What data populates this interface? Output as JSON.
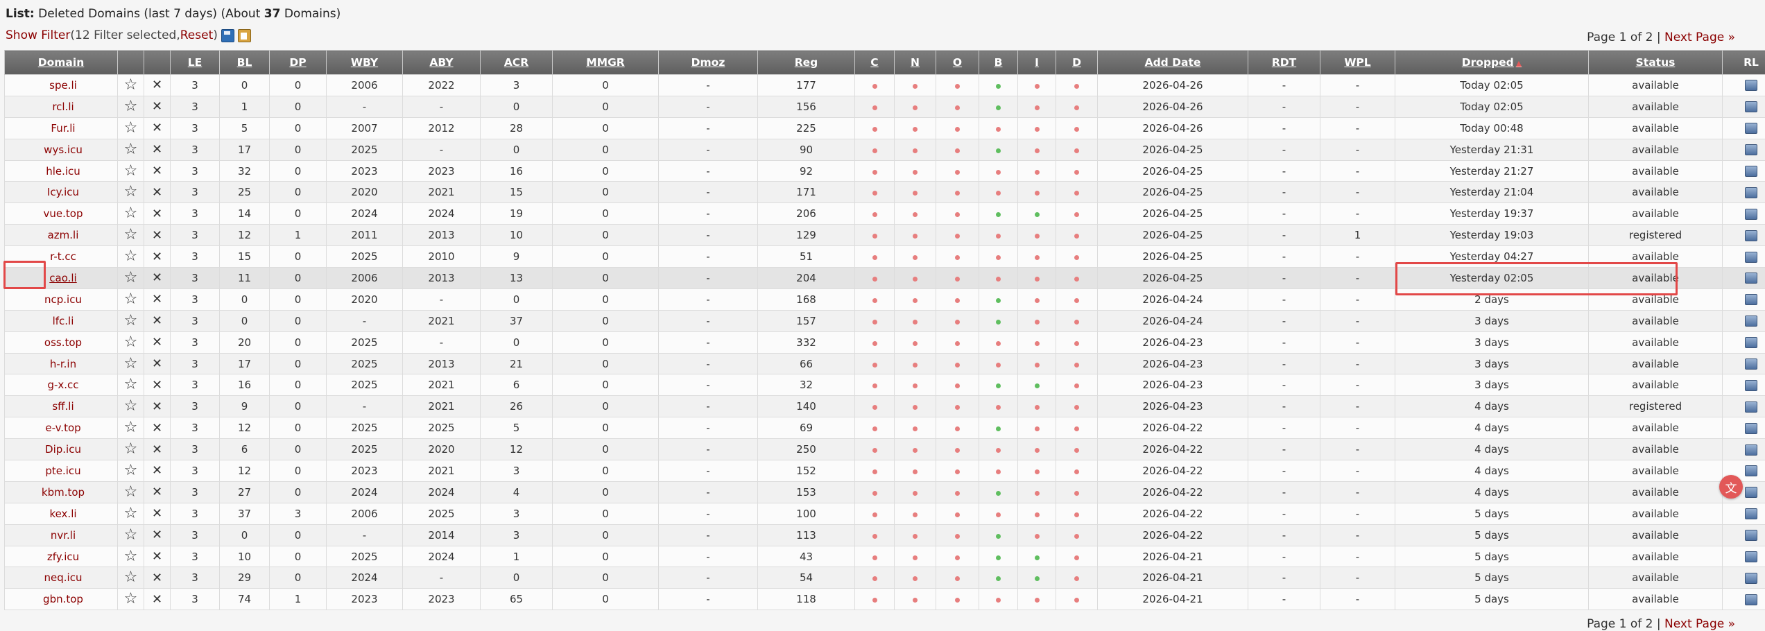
{
  "header": {
    "list_label": "List:",
    "list_prefix": " Deleted Domains (last 7 days) (About ",
    "count": "37",
    "list_suffix": " Domains)"
  },
  "filter": {
    "show_filter": "Show Filter",
    "open": " (",
    "info": "12 Filter selected, ",
    "reset": "Reset",
    "close": ")",
    "save_icon": "save-icon",
    "clipboard_icon": "clipboard-icon"
  },
  "pager": {
    "text": "Page 1 of 2 | ",
    "next": "Next Page »"
  },
  "columns": [
    "Domain",
    "",
    "",
    "LE",
    "BL",
    "DP",
    "WBY",
    "ABY",
    "ACR",
    "MMGR",
    "Dmoz",
    "Reg",
    "C",
    "N",
    "O",
    "B",
    "I",
    "D",
    "Add Date",
    "RDT",
    "WPL",
    "Dropped",
    "Status",
    "RL"
  ],
  "rows": [
    {
      "domain": "spe.li",
      "le": "3",
      "bl": "0",
      "dp": "0",
      "wby": "2006",
      "aby": "2022",
      "acr": "3",
      "mmgr": "0",
      "dmoz": "-",
      "reg": "177",
      "c": "r",
      "n": "r",
      "o": "r",
      "b": "g",
      "i": "r",
      "d": "r",
      "add_date": "2026-04-26",
      "rdt": "-",
      "wpl": "-",
      "dropped": "Today 02:05",
      "status": "available"
    },
    {
      "domain": "rcl.li",
      "le": "3",
      "bl": "1",
      "dp": "0",
      "wby": "-",
      "aby": "-",
      "acr": "0",
      "mmgr": "0",
      "dmoz": "-",
      "reg": "156",
      "c": "r",
      "n": "r",
      "o": "r",
      "b": "g",
      "i": "r",
      "d": "r",
      "add_date": "2026-04-26",
      "rdt": "-",
      "wpl": "-",
      "dropped": "Today 02:05",
      "status": "available"
    },
    {
      "domain": "Fur.li",
      "le": "3",
      "bl": "5",
      "dp": "0",
      "wby": "2007",
      "aby": "2012",
      "acr": "28",
      "mmgr": "0",
      "dmoz": "-",
      "reg": "225",
      "c": "r",
      "n": "r",
      "o": "r",
      "b": "r",
      "i": "r",
      "d": "r",
      "add_date": "2026-04-26",
      "rdt": "-",
      "wpl": "-",
      "dropped": "Today 00:48",
      "status": "available"
    },
    {
      "domain": "wys.icu",
      "le": "3",
      "bl": "17",
      "dp": "0",
      "wby": "2025",
      "aby": "-",
      "acr": "0",
      "mmgr": "0",
      "dmoz": "-",
      "reg": "90",
      "c": "r",
      "n": "r",
      "o": "r",
      "b": "g",
      "i": "r",
      "d": "r",
      "add_date": "2026-04-25",
      "rdt": "-",
      "wpl": "-",
      "dropped": "Yesterday 21:31",
      "status": "available"
    },
    {
      "domain": "hle.icu",
      "le": "3",
      "bl": "32",
      "dp": "0",
      "wby": "2023",
      "aby": "2023",
      "acr": "16",
      "mmgr": "0",
      "dmoz": "-",
      "reg": "92",
      "c": "r",
      "n": "r",
      "o": "r",
      "b": "r",
      "i": "r",
      "d": "r",
      "add_date": "2026-04-25",
      "rdt": "-",
      "wpl": "-",
      "dropped": "Yesterday 21:27",
      "status": "available"
    },
    {
      "domain": "Icy.icu",
      "le": "3",
      "bl": "25",
      "dp": "0",
      "wby": "2020",
      "aby": "2021",
      "acr": "15",
      "mmgr": "0",
      "dmoz": "-",
      "reg": "171",
      "c": "r",
      "n": "r",
      "o": "r",
      "b": "r",
      "i": "r",
      "d": "r",
      "add_date": "2026-04-25",
      "rdt": "-",
      "wpl": "-",
      "dropped": "Yesterday 21:04",
      "status": "available"
    },
    {
      "domain": "vue.top",
      "le": "3",
      "bl": "14",
      "dp": "0",
      "wby": "2024",
      "aby": "2024",
      "acr": "19",
      "mmgr": "0",
      "dmoz": "-",
      "reg": "206",
      "c": "r",
      "n": "r",
      "o": "r",
      "b": "g",
      "i": "g",
      "d": "r",
      "add_date": "2026-04-25",
      "rdt": "-",
      "wpl": "-",
      "dropped": "Yesterday 19:37",
      "status": "available"
    },
    {
      "domain": "azm.li",
      "le": "3",
      "bl": "12",
      "dp": "1",
      "wby": "2011",
      "aby": "2013",
      "acr": "10",
      "mmgr": "0",
      "dmoz": "-",
      "reg": "129",
      "c": "r",
      "n": "r",
      "o": "r",
      "b": "r",
      "i": "r",
      "d": "r",
      "add_date": "2026-04-25",
      "rdt": "-",
      "wpl": "1",
      "dropped": "Yesterday 19:03",
      "status": "registered"
    },
    {
      "domain": "r-t.cc",
      "le": "3",
      "bl": "15",
      "dp": "0",
      "wby": "2025",
      "aby": "2010",
      "acr": "9",
      "mmgr": "0",
      "dmoz": "-",
      "reg": "51",
      "c": "r",
      "n": "r",
      "o": "r",
      "b": "r",
      "i": "r",
      "d": "r",
      "add_date": "2026-04-25",
      "rdt": "-",
      "wpl": "-",
      "dropped": "Yesterday 04:27",
      "status": "available"
    },
    {
      "domain": "cao.li",
      "le": "3",
      "bl": "11",
      "dp": "0",
      "wby": "2006",
      "aby": "2013",
      "acr": "13",
      "mmgr": "0",
      "dmoz": "-",
      "reg": "204",
      "c": "r",
      "n": "r",
      "o": "r",
      "b": "r",
      "i": "r",
      "d": "r",
      "add_date": "2026-04-25",
      "rdt": "-",
      "wpl": "-",
      "dropped": "Yesterday 02:05",
      "status": "available"
    },
    {
      "domain": "ncp.icu",
      "le": "3",
      "bl": "0",
      "dp": "0",
      "wby": "2020",
      "aby": "-",
      "acr": "0",
      "mmgr": "0",
      "dmoz": "-",
      "reg": "168",
      "c": "r",
      "n": "r",
      "o": "r",
      "b": "g",
      "i": "r",
      "d": "r",
      "add_date": "2026-04-24",
      "rdt": "-",
      "wpl": "-",
      "dropped": "2 days",
      "status": "available"
    },
    {
      "domain": "lfc.li",
      "le": "3",
      "bl": "0",
      "dp": "0",
      "wby": "-",
      "aby": "2021",
      "acr": "37",
      "mmgr": "0",
      "dmoz": "-",
      "reg": "157",
      "c": "r",
      "n": "r",
      "o": "r",
      "b": "g",
      "i": "r",
      "d": "r",
      "add_date": "2026-04-24",
      "rdt": "-",
      "wpl": "-",
      "dropped": "3 days",
      "status": "available"
    },
    {
      "domain": "oss.top",
      "le": "3",
      "bl": "20",
      "dp": "0",
      "wby": "2025",
      "aby": "-",
      "acr": "0",
      "mmgr": "0",
      "dmoz": "-",
      "reg": "332",
      "c": "r",
      "n": "r",
      "o": "r",
      "b": "r",
      "i": "r",
      "d": "r",
      "add_date": "2026-04-23",
      "rdt": "-",
      "wpl": "-",
      "dropped": "3 days",
      "status": "available"
    },
    {
      "domain": "h-r.in",
      "le": "3",
      "bl": "17",
      "dp": "0",
      "wby": "2025",
      "aby": "2013",
      "acr": "21",
      "mmgr": "0",
      "dmoz": "-",
      "reg": "66",
      "c": "r",
      "n": "r",
      "o": "r",
      "b": "r",
      "i": "r",
      "d": "r",
      "add_date": "2026-04-23",
      "rdt": "-",
      "wpl": "-",
      "dropped": "3 days",
      "status": "available"
    },
    {
      "domain": "g-x.cc",
      "le": "3",
      "bl": "16",
      "dp": "0",
      "wby": "2025",
      "aby": "2021",
      "acr": "6",
      "mmgr": "0",
      "dmoz": "-",
      "reg": "32",
      "c": "r",
      "n": "r",
      "o": "r",
      "b": "g",
      "i": "g",
      "d": "r",
      "add_date": "2026-04-23",
      "rdt": "-",
      "wpl": "-",
      "dropped": "3 days",
      "status": "available"
    },
    {
      "domain": "sff.li",
      "le": "3",
      "bl": "9",
      "dp": "0",
      "wby": "-",
      "aby": "2021",
      "acr": "26",
      "mmgr": "0",
      "dmoz": "-",
      "reg": "140",
      "c": "r",
      "n": "r",
      "o": "r",
      "b": "r",
      "i": "r",
      "d": "r",
      "add_date": "2026-04-23",
      "rdt": "-",
      "wpl": "-",
      "dropped": "4 days",
      "status": "registered"
    },
    {
      "domain": "e-v.top",
      "le": "3",
      "bl": "12",
      "dp": "0",
      "wby": "2025",
      "aby": "2025",
      "acr": "5",
      "mmgr": "0",
      "dmoz": "-",
      "reg": "69",
      "c": "r",
      "n": "r",
      "o": "r",
      "b": "g",
      "i": "r",
      "d": "r",
      "add_date": "2026-04-22",
      "rdt": "-",
      "wpl": "-",
      "dropped": "4 days",
      "status": "available"
    },
    {
      "domain": "Dip.icu",
      "le": "3",
      "bl": "6",
      "dp": "0",
      "wby": "2025",
      "aby": "2020",
      "acr": "12",
      "mmgr": "0",
      "dmoz": "-",
      "reg": "250",
      "c": "r",
      "n": "r",
      "o": "r",
      "b": "r",
      "i": "r",
      "d": "r",
      "add_date": "2026-04-22",
      "rdt": "-",
      "wpl": "-",
      "dropped": "4 days",
      "status": "available"
    },
    {
      "domain": "pte.icu",
      "le": "3",
      "bl": "12",
      "dp": "0",
      "wby": "2023",
      "aby": "2021",
      "acr": "3",
      "mmgr": "0",
      "dmoz": "-",
      "reg": "152",
      "c": "r",
      "n": "r",
      "o": "r",
      "b": "r",
      "i": "r",
      "d": "r",
      "add_date": "2026-04-22",
      "rdt": "-",
      "wpl": "-",
      "dropped": "4 days",
      "status": "available"
    },
    {
      "domain": "kbm.top",
      "le": "3",
      "bl": "27",
      "dp": "0",
      "wby": "2024",
      "aby": "2024",
      "acr": "4",
      "mmgr": "0",
      "dmoz": "-",
      "reg": "153",
      "c": "r",
      "n": "r",
      "o": "r",
      "b": "g",
      "i": "r",
      "d": "r",
      "add_date": "2026-04-22",
      "rdt": "-",
      "wpl": "-",
      "dropped": "4 days",
      "status": "available"
    },
    {
      "domain": "kex.li",
      "le": "3",
      "bl": "37",
      "dp": "3",
      "wby": "2006",
      "aby": "2025",
      "acr": "3",
      "mmgr": "0",
      "dmoz": "-",
      "reg": "100",
      "c": "r",
      "n": "r",
      "o": "r",
      "b": "r",
      "i": "r",
      "d": "r",
      "add_date": "2026-04-22",
      "rdt": "-",
      "wpl": "-",
      "dropped": "5 days",
      "status": "available"
    },
    {
      "domain": "nvr.li",
      "le": "3",
      "bl": "0",
      "dp": "0",
      "wby": "-",
      "aby": "2014",
      "acr": "3",
      "mmgr": "0",
      "dmoz": "-",
      "reg": "113",
      "c": "r",
      "n": "r",
      "o": "r",
      "b": "g",
      "i": "r",
      "d": "r",
      "add_date": "2026-04-22",
      "rdt": "-",
      "wpl": "-",
      "dropped": "5 days",
      "status": "available"
    },
    {
      "domain": "zfy.icu",
      "le": "3",
      "bl": "10",
      "dp": "0",
      "wby": "2025",
      "aby": "2024",
      "acr": "1",
      "mmgr": "0",
      "dmoz": "-",
      "reg": "43",
      "c": "r",
      "n": "r",
      "o": "r",
      "b": "g",
      "i": "g",
      "d": "r",
      "add_date": "2026-04-21",
      "rdt": "-",
      "wpl": "-",
      "dropped": "5 days",
      "status": "available"
    },
    {
      "domain": "neq.icu",
      "le": "3",
      "bl": "29",
      "dp": "0",
      "wby": "2024",
      "aby": "-",
      "acr": "0",
      "mmgr": "0",
      "dmoz": "-",
      "reg": "54",
      "c": "r",
      "n": "r",
      "o": "r",
      "b": "g",
      "i": "g",
      "d": "r",
      "add_date": "2026-04-21",
      "rdt": "-",
      "wpl": "-",
      "dropped": "5 days",
      "status": "available"
    },
    {
      "domain": "gbn.top",
      "le": "3",
      "bl": "74",
      "dp": "1",
      "wby": "2023",
      "aby": "2023",
      "acr": "65",
      "mmgr": "0",
      "dmoz": "-",
      "reg": "118",
      "c": "r",
      "n": "r",
      "o": "r",
      "b": "r",
      "i": "r",
      "d": "r",
      "add_date": "2026-04-21",
      "rdt": "-",
      "wpl": "-",
      "dropped": "5 days",
      "status": "available"
    }
  ],
  "icons": {
    "fav": "star-icon",
    "delete": "close-icon",
    "rl": "whois-icon",
    "dropped_sort": "sort-icon",
    "translate": "translate-icon"
  },
  "colors": {
    "link": "#8b0000",
    "available": "#1f8c1f",
    "registered": "#999999",
    "dot_red": "#e77e7e",
    "dot_green": "#5fbe5f",
    "highlight_box": "#e24848",
    "header_bg": "#6e6e6e"
  },
  "highlight_row": 9
}
